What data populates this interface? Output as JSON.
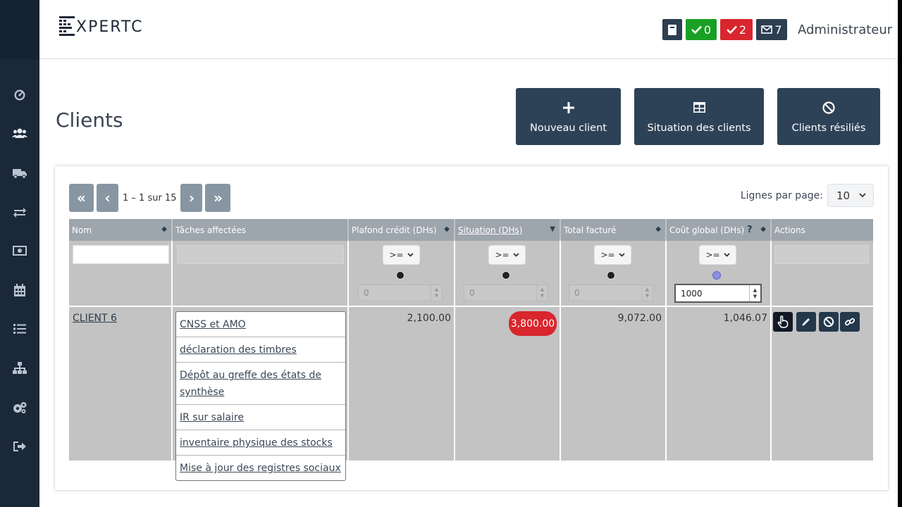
{
  "app": {
    "logo_text": "XPERTC",
    "user_label": "Administrateur"
  },
  "header_badges": [
    {
      "icon": "book-icon",
      "count": "",
      "color": "#2c3e50"
    },
    {
      "icon": "check-icon",
      "count": "0",
      "color": "#19a024"
    },
    {
      "icon": "check-icon",
      "count": "2",
      "color": "#d9252e"
    },
    {
      "icon": "envelope-icon",
      "count": "7",
      "color": "#2c3e50"
    }
  ],
  "sidebar": {
    "items": [
      {
        "icon": "dashboard-icon"
      },
      {
        "icon": "users-icon"
      },
      {
        "icon": "truck-icon"
      },
      {
        "icon": "exchange-icon"
      },
      {
        "icon": "money-icon"
      },
      {
        "icon": "calendar-icon"
      },
      {
        "icon": "list-icon"
      },
      {
        "icon": "sitemap-icon"
      },
      {
        "icon": "cogs-icon"
      },
      {
        "icon": "sign-out-icon"
      }
    ]
  },
  "page": {
    "title": "Clients"
  },
  "actions": {
    "new_client": "Nouveau client",
    "clients_situation": "Situation des clients",
    "terminated_clients": "Clients résiliés"
  },
  "pagination": {
    "first": "«",
    "prev": "‹",
    "info": "1 – 1 sur 15",
    "next": "›",
    "last": "»",
    "rows_per_page_label": "Lignes par page:",
    "rows_per_page_value": "10"
  },
  "table": {
    "columns": {
      "nom": "Nom",
      "taches": "Tâches affectées",
      "plafond": "Plafond crédit (DHs)",
      "situation": "Situation (DHs)",
      "total": "Total facturé",
      "cout": "Coût global (DHs)",
      "cout_help": "?",
      "actions": "Actions"
    },
    "filters": {
      "operator": ">=",
      "plafond_value": "0",
      "situation_value": "0",
      "total_value": "0",
      "cout_value": "1000"
    },
    "rows": [
      {
        "nom": "CLIENT 6",
        "taches": [
          "CNSS et AMO",
          "déclaration des timbres",
          "Dépôt au greffe des états de synthèse",
          "IR sur salaire",
          "inventaire physique des stocks",
          "Mise à jour des registres sociaux"
        ],
        "plafond": "2,100.00",
        "situation": "3,800.00",
        "situation_color": "#d9252e",
        "total": "9,072.00",
        "cout": "1,046.07"
      }
    ]
  }
}
